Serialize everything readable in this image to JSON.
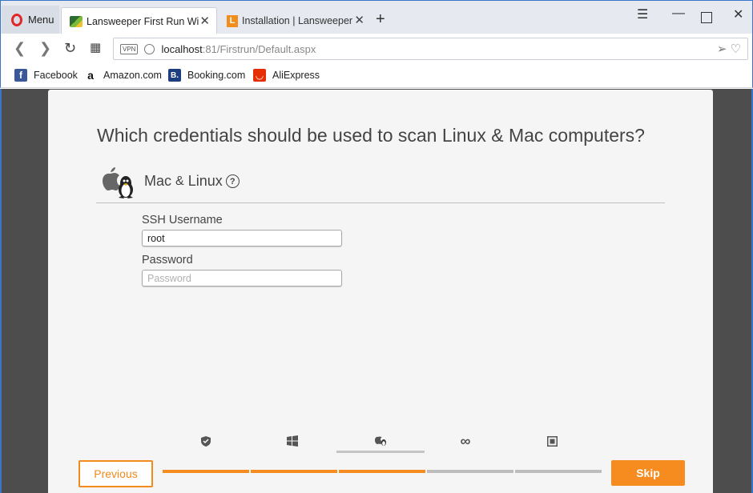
{
  "browser": {
    "menu_label": "Menu",
    "tabs": [
      {
        "title": "Lansweeper First Run Wizard",
        "active": true
      },
      {
        "title": "Installation | Lansweeper IT Asset Management",
        "active": false
      }
    ],
    "address": {
      "vpn_label": "VPN",
      "host": "localhost",
      "path": ":81/Firstrun/Default.aspx"
    },
    "bookmarks": [
      {
        "label": "Facebook",
        "icon": "facebook-icon",
        "color": "#3b5998",
        "glyph": "f"
      },
      {
        "label": "Amazon.com",
        "icon": "amazon-icon",
        "color": "#ffffff",
        "glyph": "a"
      },
      {
        "label": "Booking.com",
        "icon": "booking-icon",
        "color": "#1d3f7f",
        "glyph": "B."
      },
      {
        "label": "AliExpress",
        "icon": "aliexpress-icon",
        "color": "#e62e04",
        "glyph": "◡"
      }
    ]
  },
  "wizard": {
    "heading": "Which credentials should be used to scan Linux & Mac computers?",
    "section": {
      "title_left": "Mac",
      "title_amp": "&",
      "title_right": "Linux",
      "help_glyph": "?"
    },
    "fields": [
      {
        "label": "SSH Username",
        "value": "root",
        "placeholder": ""
      },
      {
        "label": "Password",
        "value": "",
        "placeholder": "Password"
      }
    ],
    "steps": [
      {
        "name": "shield-icon",
        "glyph": "◼"
      },
      {
        "name": "windows-icon",
        "glyph": "⊞"
      },
      {
        "name": "apple-linux-icon",
        "glyph": ""
      },
      {
        "name": "infinity-icon",
        "glyph": "∞"
      },
      {
        "name": "box-icon",
        "glyph": "▣"
      }
    ],
    "current_step": 2,
    "progress_complete_segments": 3,
    "progress_total_segments": 5,
    "buttons": {
      "previous": "Previous",
      "skip": "Skip"
    },
    "colors": {
      "accent": "#f68b1f",
      "progress_done": "#f68b1f",
      "progress_todo": "#bdbdbd"
    }
  }
}
